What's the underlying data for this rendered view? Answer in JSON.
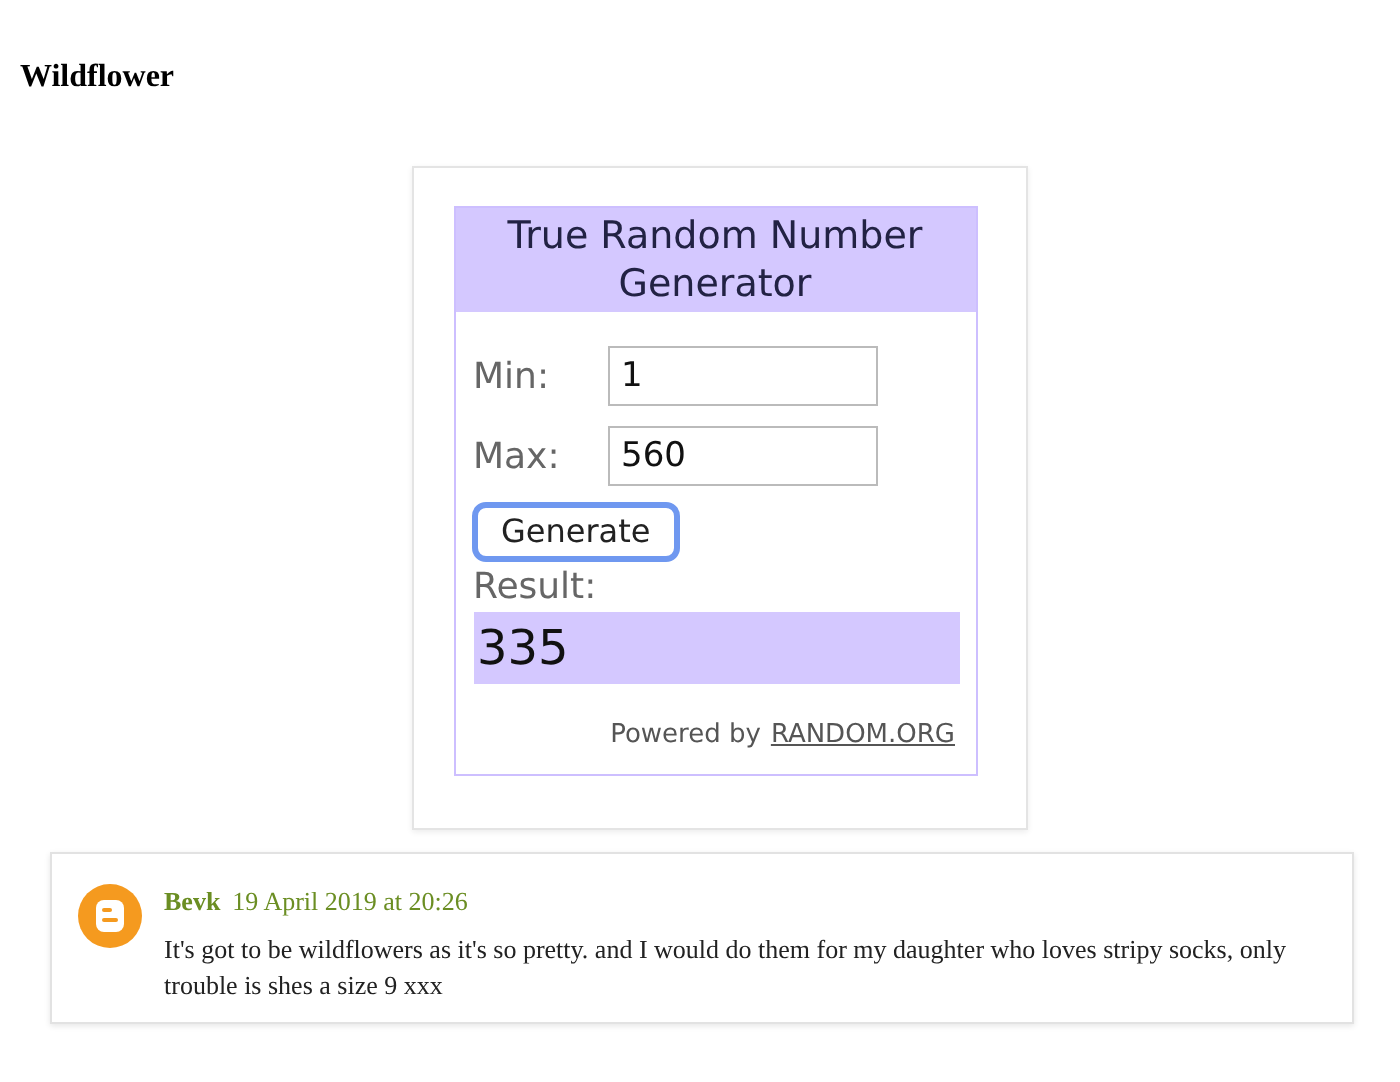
{
  "post_title": "Wildflower",
  "generator": {
    "title": "True Random Number Generator",
    "fields": [
      {
        "label": "Min:",
        "value": "1"
      },
      {
        "label": "Max:",
        "value": "560"
      }
    ],
    "button": {
      "label": "Generate",
      "focused": true
    },
    "result_label": "Result:",
    "result": "335",
    "powered_by": "Powered by",
    "powered_link": "RANDOM.ORG"
  },
  "comment": {
    "author": "Bevk",
    "date": "19 April 2019 at 20:26",
    "text": "It's got to be wildflowers as it's so pretty. and I would do them for my daughter who loves stripy socks, only trouble is shes a size 9 xxx"
  }
}
